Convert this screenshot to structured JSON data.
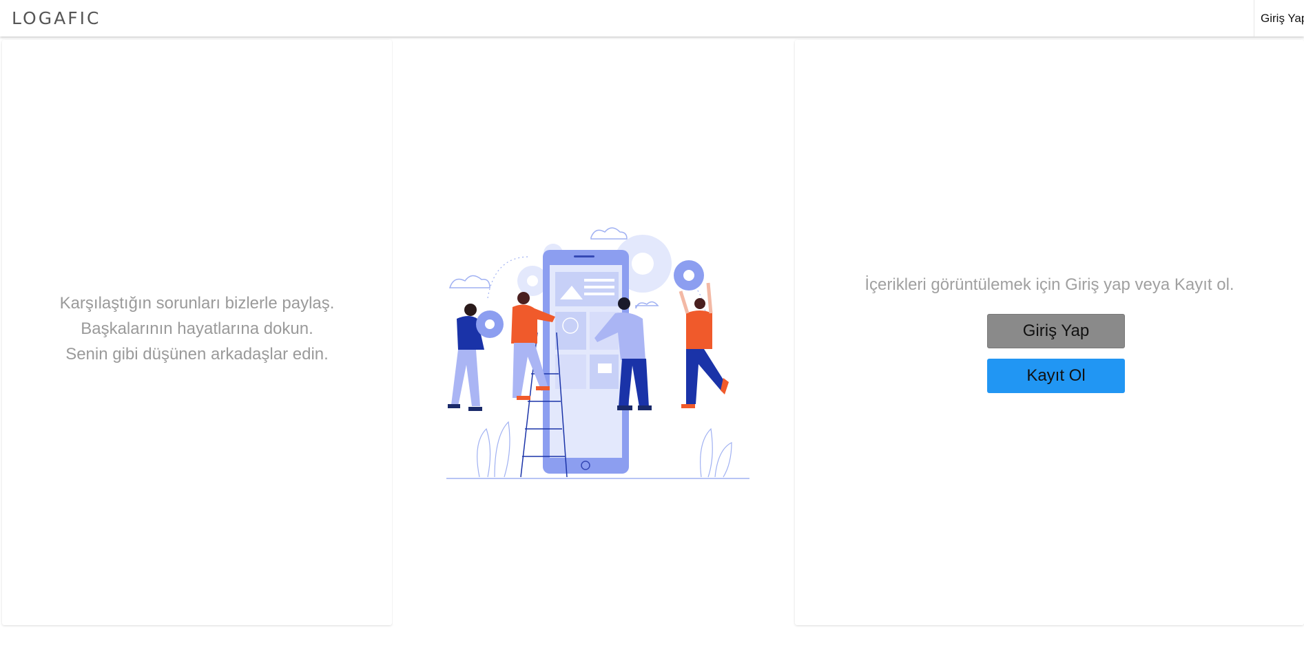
{
  "header": {
    "logo": "LOGAFIC",
    "login_link": "Giriş Yap"
  },
  "left_panel": {
    "lines": [
      "Karşılaştığın sorunları bizlerle paylaş.",
      "Başkalarının hayatlarına dokun.",
      "Senin gibi düşünen arkadaşlar edin."
    ]
  },
  "right_panel": {
    "prompt": "İçerikleri görüntülemek için Giriş yap veya Kayıt ol.",
    "login_button": "Giriş Yap",
    "register_button": "Kayıt Ol"
  },
  "colors": {
    "login_button_bg": "#8a8a8a",
    "register_button_bg": "#2196f3",
    "illustration_blue": "#8c9ef0",
    "illustration_orange": "#f05a2b",
    "illustration_navy": "#1a33a8"
  }
}
